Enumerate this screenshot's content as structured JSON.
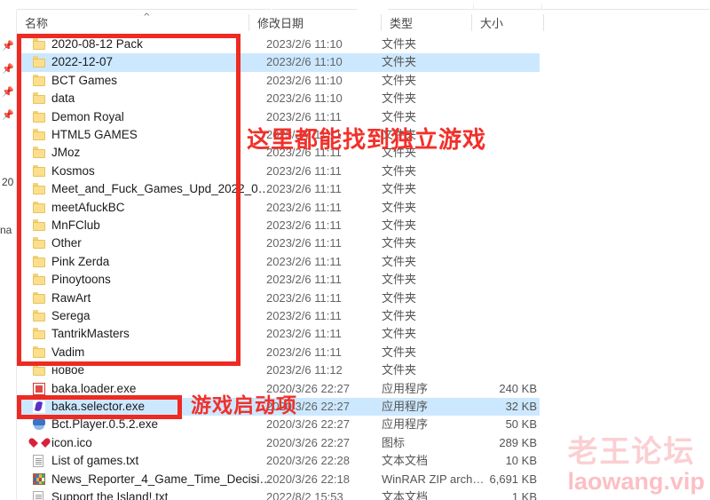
{
  "window": {
    "app": "file-explorer"
  },
  "columns": {
    "name": "名称",
    "date_modified": "修改日期",
    "type": "类型",
    "size": "大小",
    "sort_caret": "^"
  },
  "nav_pane": {
    "fragments": [
      "20",
      "na"
    ]
  },
  "files": [
    {
      "name": "2020-08-12 Pack",
      "date": "2023/2/6 11:10",
      "type": "文件夹",
      "size": "",
      "icon": "folder-icon",
      "selected": false
    },
    {
      "name": "2022-12-07",
      "date": "2023/2/6 11:10",
      "type": "文件夹",
      "size": "",
      "icon": "folder-icon",
      "selected": true
    },
    {
      "name": "BCT Games",
      "date": "2023/2/6 11:10",
      "type": "文件夹",
      "size": "",
      "icon": "folder-icon",
      "selected": false
    },
    {
      "name": "data",
      "date": "2023/2/6 11:10",
      "type": "文件夹",
      "size": "",
      "icon": "folder-icon",
      "selected": false
    },
    {
      "name": "Demon Royal",
      "date": "2023/2/6 11:11",
      "type": "文件夹",
      "size": "",
      "icon": "folder-icon",
      "selected": false
    },
    {
      "name": "HTML5 GAMES",
      "date": "2023/2/6 11:11",
      "type": "文件夹",
      "size": "",
      "icon": "folder-icon",
      "selected": false
    },
    {
      "name": "JMoz",
      "date": "2023/2/6 11:11",
      "type": "文件夹",
      "size": "",
      "icon": "folder-icon",
      "selected": false
    },
    {
      "name": "Kosmos",
      "date": "2023/2/6 11:11",
      "type": "文件夹",
      "size": "",
      "icon": "folder-icon",
      "selected": false
    },
    {
      "name": "Meet_and_Fuck_Games_Upd_2022_0…",
      "date": "2023/2/6 11:11",
      "type": "文件夹",
      "size": "",
      "icon": "folder-icon",
      "selected": false
    },
    {
      "name": "meetAfuckBC",
      "date": "2023/2/6 11:11",
      "type": "文件夹",
      "size": "",
      "icon": "folder-icon",
      "selected": false
    },
    {
      "name": "MnFClub",
      "date": "2023/2/6 11:11",
      "type": "文件夹",
      "size": "",
      "icon": "folder-icon",
      "selected": false
    },
    {
      "name": "Other",
      "date": "2023/2/6 11:11",
      "type": "文件夹",
      "size": "",
      "icon": "folder-icon",
      "selected": false
    },
    {
      "name": "Pink Zerda",
      "date": "2023/2/6 11:11",
      "type": "文件夹",
      "size": "",
      "icon": "folder-icon",
      "selected": false
    },
    {
      "name": "Pinoytoons",
      "date": "2023/2/6 11:11",
      "type": "文件夹",
      "size": "",
      "icon": "folder-icon",
      "selected": false
    },
    {
      "name": "RawArt",
      "date": "2023/2/6 11:11",
      "type": "文件夹",
      "size": "",
      "icon": "folder-icon",
      "selected": false
    },
    {
      "name": "Serega",
      "date": "2023/2/6 11:11",
      "type": "文件夹",
      "size": "",
      "icon": "folder-icon",
      "selected": false
    },
    {
      "name": "TantrikMasters",
      "date": "2023/2/6 11:11",
      "type": "文件夹",
      "size": "",
      "icon": "folder-icon",
      "selected": false
    },
    {
      "name": "Vadim",
      "date": "2023/2/6 11:11",
      "type": "文件夹",
      "size": "",
      "icon": "folder-icon",
      "selected": false
    },
    {
      "name": "новое",
      "date": "2023/2/6 11:12",
      "type": "文件夹",
      "size": "",
      "icon": "folder-icon",
      "selected": false
    },
    {
      "name": "baka.loader.exe",
      "date": "2020/3/26 22:27",
      "type": "应用程序",
      "size": "240 KB",
      "icon": "exe-red-icon",
      "selected": false
    },
    {
      "name": "baka.selector.exe",
      "date": "2020/3/26 22:27",
      "type": "应用程序",
      "size": "32 KB",
      "icon": "exe-purple-icon",
      "selected": true
    },
    {
      "name": "Bct.Player.0.5.2.exe",
      "date": "2020/3/26 22:27",
      "type": "应用程序",
      "size": "50 KB",
      "icon": "bct-player-icon",
      "selected": false
    },
    {
      "name": "icon.ico",
      "date": "2020/3/26 22:27",
      "type": "图标",
      "size": "289 KB",
      "icon": "heart-icon",
      "selected": false
    },
    {
      "name": "List of games.txt",
      "date": "2020/3/26 22:28",
      "type": "文本文档",
      "size": "10 KB",
      "icon": "text-file-icon",
      "selected": false
    },
    {
      "name": "News_Reporter_4_Game_Time_Decisi…",
      "date": "2020/3/26 22:18",
      "type": "WinRAR ZIP arch…",
      "size": "6,691 KB",
      "icon": "winrar-icon",
      "selected": false
    },
    {
      "name": "Support the Island!.txt",
      "date": "2022/8/2 15:53",
      "type": "文本文档",
      "size": "1 KB",
      "icon": "text-file-icon",
      "selected": false
    }
  ],
  "annotations": {
    "folders_note": "这里都能找到独立游戏",
    "selector_note": "游戏启动项",
    "box_color": "#ee2a22",
    "text_color": "#f2302a"
  },
  "watermark": {
    "cn": "老王论坛",
    "en": "laowang.vip"
  }
}
